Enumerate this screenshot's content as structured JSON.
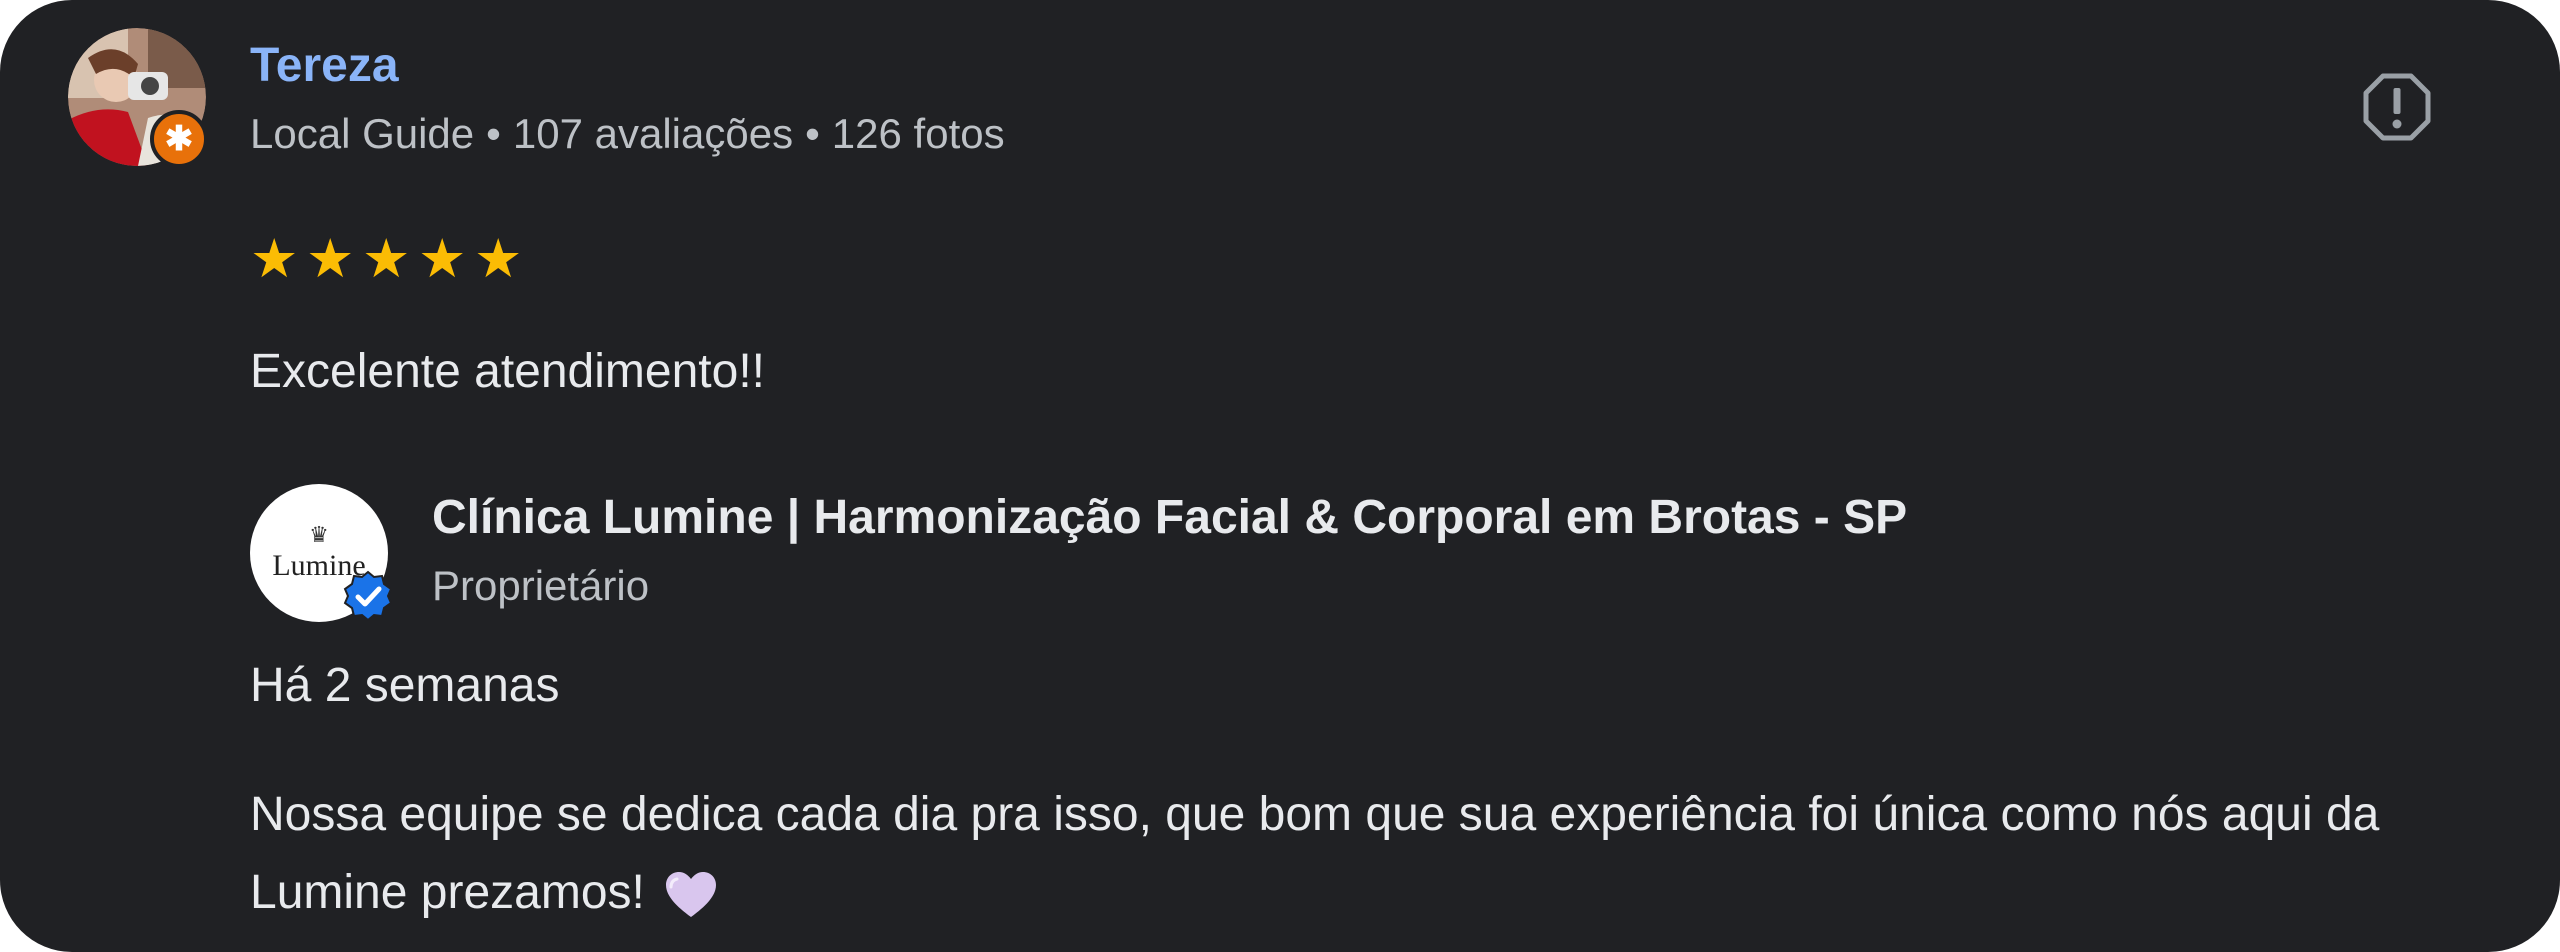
{
  "reviewer": {
    "name": "Tereza",
    "badge": "Local Guide",
    "reviews_count": "107 avaliações",
    "photos_count": "126 fotos",
    "separator": "•"
  },
  "review": {
    "rating": 5,
    "max_rating": 5,
    "text": "Excelente atendimento!!",
    "star_color": "#fbbc04"
  },
  "owner": {
    "name": "Clínica Lumine | Harmonização Facial & Corporal em Brotas - SP",
    "role": "Proprietário",
    "logo_text": "Lumine"
  },
  "reply": {
    "date": "Há 2 semanas",
    "text": "Nossa equipe se dedica cada dia pra isso, que bom que sua experiência foi única como nós aqui da Lumine prezamos!"
  },
  "icons": {
    "report": "report-flag-icon",
    "verified": "verified-check-icon",
    "heart": "light-purple-heart-emoji",
    "guide": "local-guide-badge-icon"
  },
  "colors": {
    "background": "#202124",
    "name_link": "#8ab4f8",
    "text_primary": "#e8eaed",
    "text_secondary": "#bdc1c6",
    "verified": "#1a73e8",
    "guide_badge": "#e8710a"
  }
}
